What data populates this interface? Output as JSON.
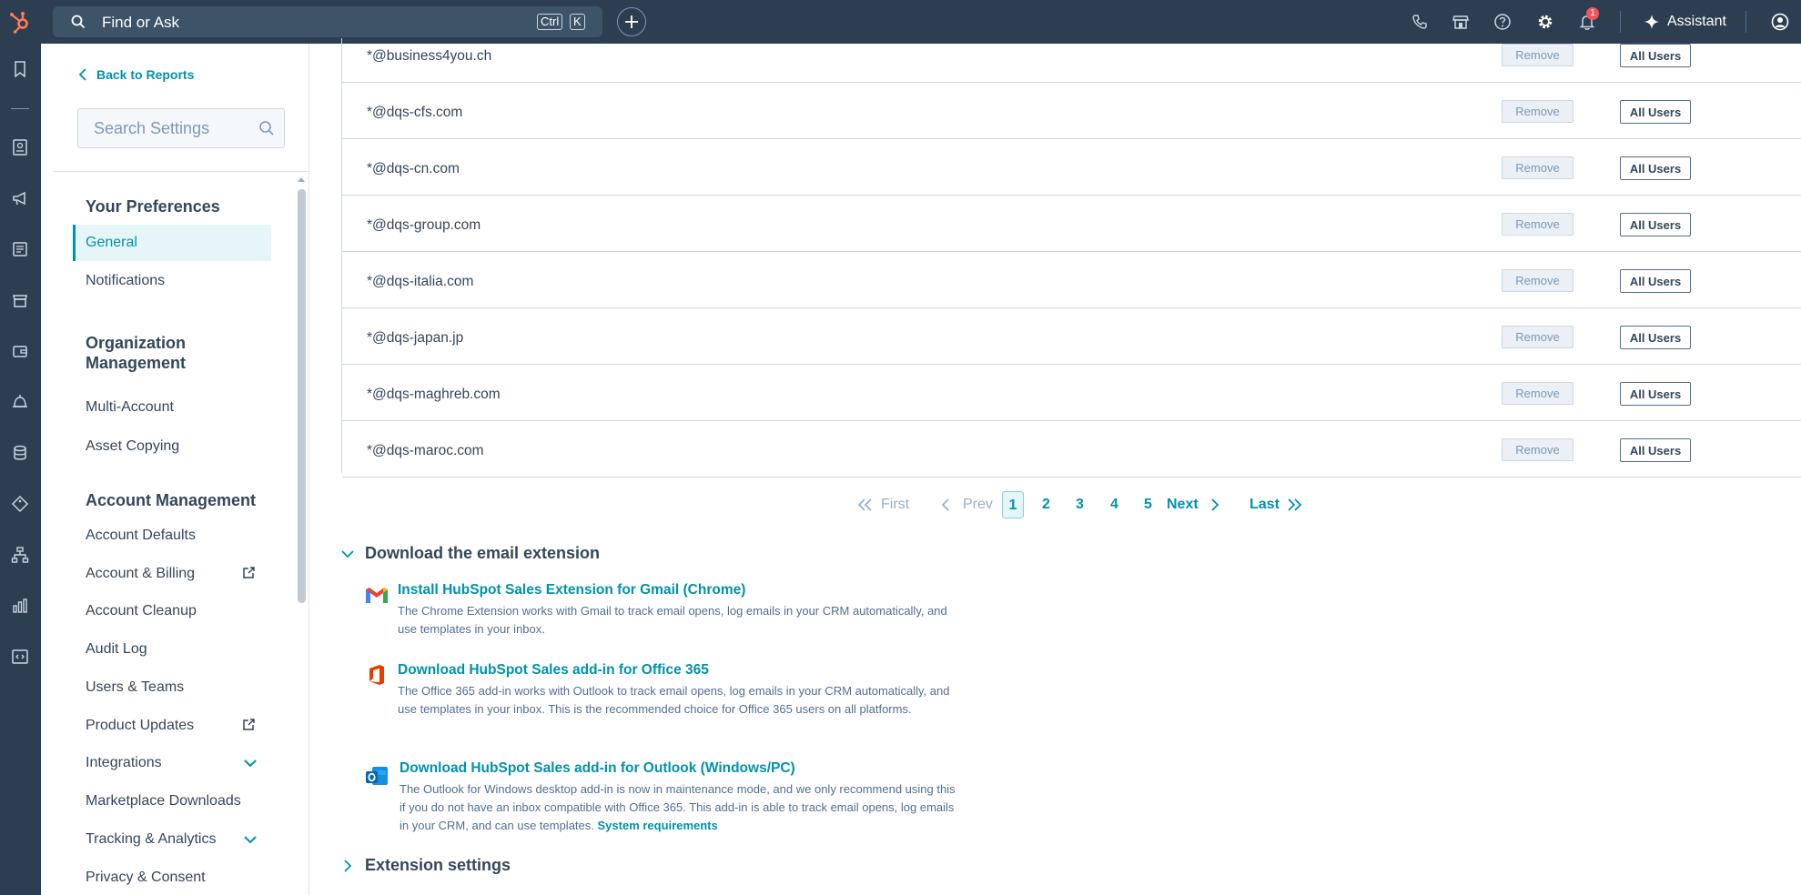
{
  "topnav": {
    "search_placeholder": "Find or Ask",
    "kbd_ctrl": "Ctrl",
    "kbd_k": "K",
    "notification_count": "1",
    "assistant_label": "Assistant"
  },
  "sidebar": {
    "back_label": "Back to Reports",
    "search_placeholder": "Search Settings",
    "sections": [
      {
        "title": "Your Preferences",
        "items": [
          "General",
          "Notifications"
        ]
      },
      {
        "title": "Organization Management",
        "items": [
          "Multi-Account",
          "Asset Copying"
        ]
      },
      {
        "title": "Account Management",
        "items": [
          "Account Defaults",
          "Account & Billing",
          "Account Cleanup",
          "Audit Log",
          "Users & Teams",
          "Product Updates",
          "Integrations",
          "Marketplace Downloads",
          "Tracking & Analytics",
          "Privacy & Consent"
        ]
      }
    ],
    "active_item": "General"
  },
  "table": {
    "rows": [
      {
        "domain": "*@business4you.ch",
        "remove": "Remove",
        "scope": "All Users"
      },
      {
        "domain": "*@dqs-cfs.com",
        "remove": "Remove",
        "scope": "All Users"
      },
      {
        "domain": "*@dqs-cn.com",
        "remove": "Remove",
        "scope": "All Users"
      },
      {
        "domain": "*@dqs-group.com",
        "remove": "Remove",
        "scope": "All Users"
      },
      {
        "domain": "*@dqs-italia.com",
        "remove": "Remove",
        "scope": "All Users"
      },
      {
        "domain": "*@dqs-japan.jp",
        "remove": "Remove",
        "scope": "All Users"
      },
      {
        "domain": "*@dqs-maghreb.com",
        "remove": "Remove",
        "scope": "All Users"
      },
      {
        "domain": "*@dqs-maroc.com",
        "remove": "Remove",
        "scope": "All Users"
      }
    ]
  },
  "pagination": {
    "first": "First",
    "prev": "Prev",
    "pages": [
      "1",
      "2",
      "3",
      "4",
      "5"
    ],
    "current": "1",
    "next": "Next",
    "last": "Last"
  },
  "download_section": {
    "title": "Download the email extension",
    "items": [
      {
        "title": "Install HubSpot Sales Extension for Gmail (Chrome)",
        "desc": "The Chrome Extension works with Gmail to track email opens, log emails in your CRM automatically, and use templates in your inbox."
      },
      {
        "title": "Download HubSpot Sales add-in for Office 365",
        "desc": "The Office 365 add-in works with Outlook to track email opens, log emails in your CRM automatically, and use templates in your inbox. This is the recommended choice for Office 365 users on all platforms."
      },
      {
        "title": "Download HubSpot Sales add-in for Outlook (Windows/PC)",
        "desc": "The Outlook for Windows desktop add-in is now in maintenance mode, and we only recommend using this if you do not have an inbox compatible with Office 365. This add-in is able to track email opens, log emails in your CRM, and can use templates.",
        "link": "System requirements"
      }
    ]
  },
  "extension_settings": {
    "title": "Extension settings"
  },
  "colors": {
    "nav_bg": "#2d3e50",
    "accent": "#0091ae",
    "text": "#33475b",
    "badge": "#f2545b"
  },
  "icons": [
    "hubspot-logo-icon",
    "search-icon",
    "plus-icon",
    "phone-icon",
    "marketplace-icon",
    "help-icon",
    "gear-icon",
    "bell-icon",
    "sparkle-icon",
    "bookmark-icon",
    "contacts-icon",
    "megaphone-icon",
    "content-icon",
    "commerce-icon",
    "wallet-icon",
    "service-icon",
    "data-icon",
    "tag-icon",
    "org-chart-icon",
    "reports-icon",
    "code-icon"
  ]
}
